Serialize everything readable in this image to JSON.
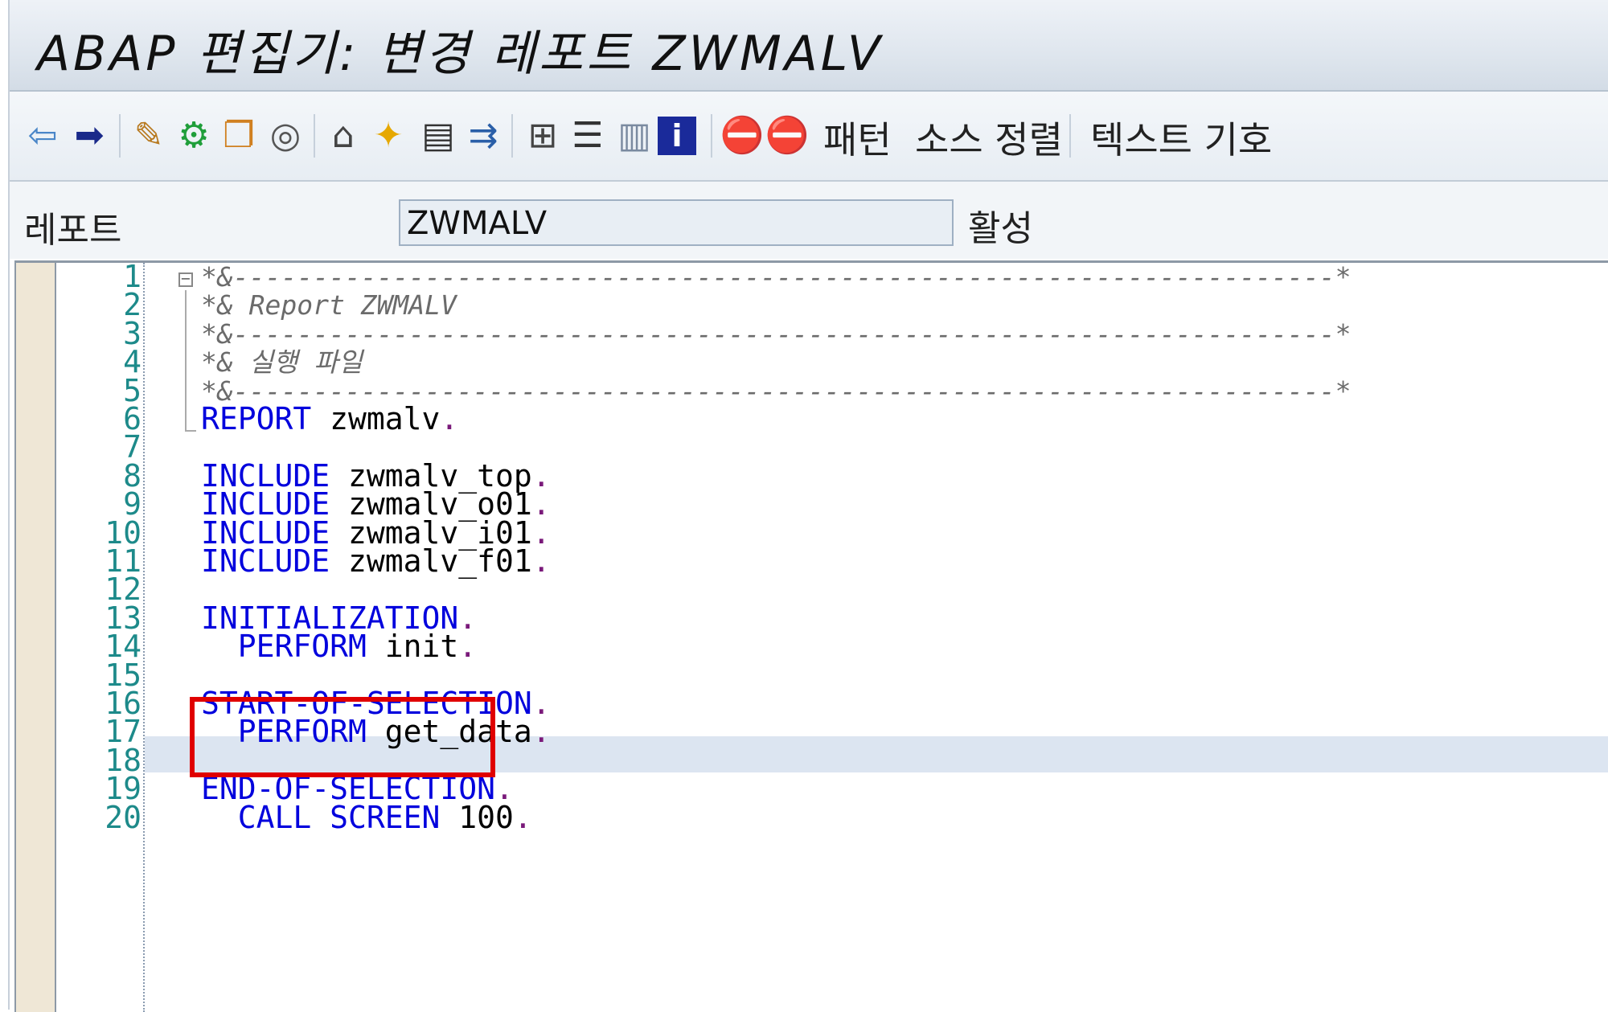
{
  "window": {
    "title": "ABAP 편집기: 변경 레포트 ZWMALV"
  },
  "toolbar": {
    "icons": [
      "back-arrow-icon",
      "forward-arrow-icon",
      "edit-pencil-icon",
      "switch-icon",
      "object-list-icon",
      "spiral-icon",
      "hierarchy-icon",
      "activate-icon",
      "display-icon",
      "navigate-icon",
      "tree-icon",
      "stack-icon",
      "list-icon",
      "info-icon",
      "breakpoint-icon",
      "session-breakpoint-icon"
    ],
    "pattern_label": "패턴",
    "pretty_print_label": "소스 정렬",
    "text_symbols_label": "텍스트 기호"
  },
  "report_field": {
    "label": "레포트",
    "value": "ZWMALV",
    "status": "활성"
  },
  "editor": {
    "lines": [
      {
        "n": "1",
        "t": "*&---------------------------------------------------------------------*",
        "type": "comment"
      },
      {
        "n": "2",
        "t": "*& Report ZWMALV",
        "type": "comment"
      },
      {
        "n": "3",
        "t": "*&---------------------------------------------------------------------*",
        "type": "comment"
      },
      {
        "n": "4",
        "t": "*& 실행 파일",
        "type": "comment"
      },
      {
        "n": "5",
        "t": "*&---------------------------------------------------------------------*",
        "type": "comment"
      },
      {
        "n": "6",
        "kw": "REPORT",
        "rest": " zwmalv",
        "type": "stmt"
      },
      {
        "n": "7",
        "type": "blank"
      },
      {
        "n": "8",
        "kw": "INCLUDE",
        "rest": " zwmalv_top",
        "type": "stmt"
      },
      {
        "n": "9",
        "kw": "INCLUDE",
        "rest": " zwmalv_o01",
        "type": "stmt"
      },
      {
        "n": "10",
        "kw": "INCLUDE",
        "rest": " zwmalv_i01",
        "type": "stmt"
      },
      {
        "n": "11",
        "kw": "INCLUDE",
        "rest": " zwmalv_f01",
        "type": "stmt"
      },
      {
        "n": "12",
        "type": "blank"
      },
      {
        "n": "13",
        "kw": "INITIALIZATION",
        "rest": "",
        "type": "stmt"
      },
      {
        "n": "14",
        "kw": "  PERFORM",
        "rest": " init",
        "type": "stmt"
      },
      {
        "n": "15",
        "type": "blank"
      },
      {
        "n": "16",
        "kw": "START-OF-SELECTION",
        "rest": "",
        "type": "stmt"
      },
      {
        "n": "17",
        "kw": "  PERFORM",
        "rest": " get_data",
        "type": "stmt"
      },
      {
        "n": "18",
        "type": "blank"
      },
      {
        "n": "19",
        "kw": "END-OF-SELECTION",
        "rest": "",
        "type": "stmt"
      },
      {
        "n": "20",
        "kw": "  CALL SCREEN",
        "rest": " 100",
        "type": "stmt"
      }
    ],
    "highlighted_line": "14",
    "colors": {
      "keyword": "#0000dd",
      "comment": "#6b6b6b",
      "line_number": "#1d8a8a",
      "highlight": "#dce5f1",
      "annotation_box": "#e00000"
    }
  }
}
